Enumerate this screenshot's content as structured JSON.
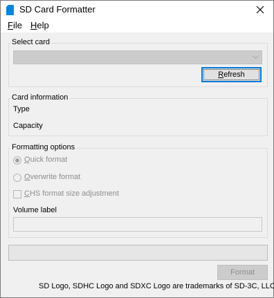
{
  "window": {
    "title": "SD Card Formatter",
    "accent": "#0078d7"
  },
  "menu": {
    "file_mnemonic": "F",
    "file_rest": "ile",
    "help_mnemonic": "H",
    "help_rest": "elp"
  },
  "select_card": {
    "title": "Select card",
    "value": "",
    "refresh_mnemonic": "R",
    "refresh_rest": "efresh"
  },
  "card_info": {
    "title": "Card information",
    "type_label": "Type",
    "capacity_label": "Capacity"
  },
  "formatting_options": {
    "title": "Formatting options",
    "quick_mnemonic": "Q",
    "quick_rest": "uick format",
    "quick_checked": true,
    "overwrite_mnemonic": "O",
    "overwrite_rest": "verwrite format",
    "overwrite_checked": false,
    "chs_mnemonic": "C",
    "chs_rest": "HS format size adjustment",
    "chs_checked": false,
    "volume_label": "Volume label",
    "volume_value": ""
  },
  "progress": {
    "value": 0
  },
  "actions": {
    "format_label": "Format"
  },
  "footer": {
    "trademark": "SD Logo, SDHC Logo and SDXC Logo are trademarks of SD-3C, LLC."
  }
}
